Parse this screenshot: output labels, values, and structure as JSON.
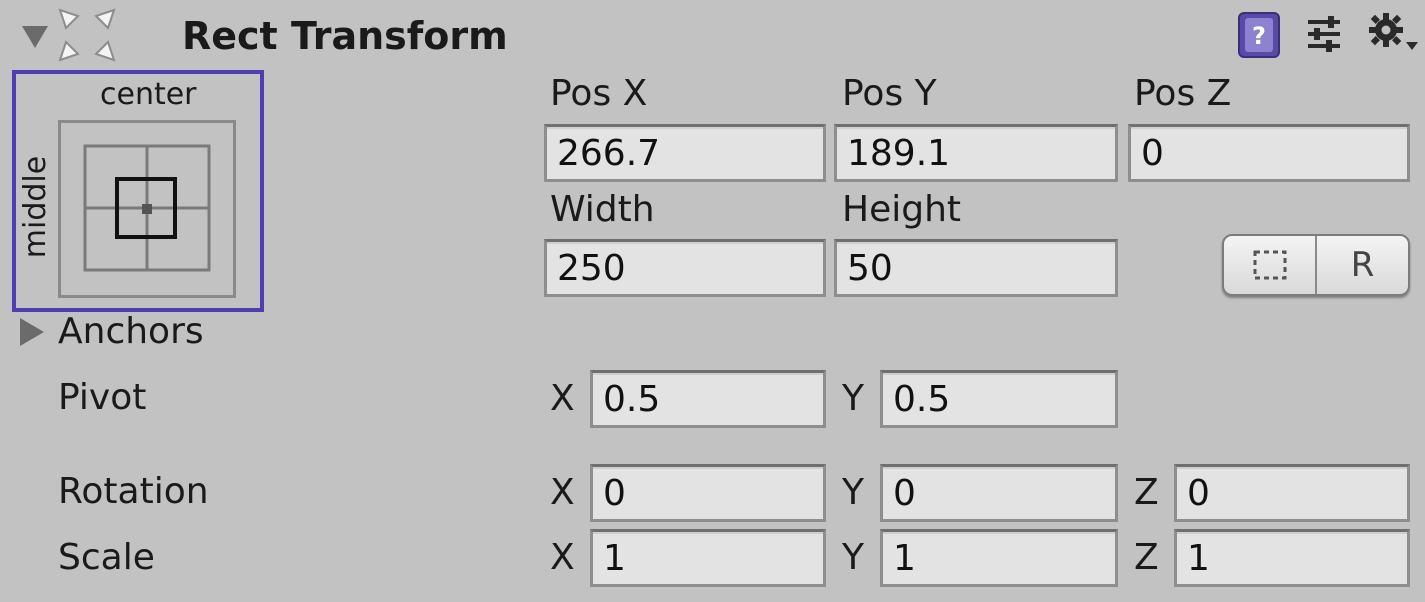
{
  "component": {
    "title": "Rect Transform",
    "icons": [
      "help-book-icon",
      "preset-sliders-icon",
      "gear-menu-icon"
    ]
  },
  "anchor_preset": {
    "horizontal": "center",
    "vertical": "middle"
  },
  "position": {
    "pos_x_label": "Pos X",
    "pos_y_label": "Pos Y",
    "pos_z_label": "Pos Z",
    "pos_x": "266.7",
    "pos_y": "189.1",
    "pos_z": "0",
    "width_label": "Width",
    "height_label": "Height",
    "width": "250",
    "height": "50"
  },
  "buttons": {
    "blueprint_icon": "dashed-rect-icon",
    "raw_label": "R"
  },
  "anchors": {
    "label": "Anchors"
  },
  "pivot": {
    "label": "Pivot",
    "x_label": "X",
    "y_label": "Y",
    "x": "0.5",
    "y": "0.5"
  },
  "rotation": {
    "label": "Rotation",
    "x_label": "X",
    "y_label": "Y",
    "z_label": "Z",
    "x": "0",
    "y": "0",
    "z": "0"
  },
  "scale": {
    "label": "Scale",
    "x_label": "X",
    "y_label": "Y",
    "z_label": "Z",
    "x": "1",
    "y": "1",
    "z": "1"
  },
  "colors": {
    "background": "#c2c2c2",
    "anchor_highlight": "#4d3fb2",
    "field_bg": "#e3e3e3"
  }
}
